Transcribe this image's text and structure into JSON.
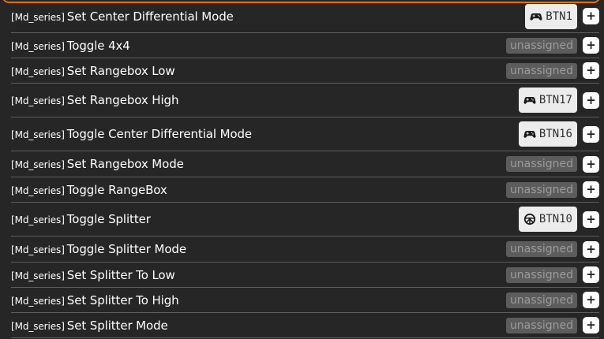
{
  "colors": {
    "background": "#262626",
    "accent": "#e0730f",
    "binding_bg": "#ececec",
    "unassigned_bg": "#5c5c5c"
  },
  "add_label": "+",
  "rows": [
    {
      "prefix": "[Md_series]",
      "name": "Set Center Differential Mode",
      "binding": "BTN1",
      "icon": "gamepad-icon"
    },
    {
      "prefix": "[Md_series]",
      "name": "Toggle 4x4",
      "binding": "unassigned",
      "icon": ""
    },
    {
      "prefix": "[Md_series]",
      "name": "Set Rangebox Low",
      "binding": "unassigned",
      "icon": ""
    },
    {
      "prefix": "[Md_series]",
      "name": "Set Rangebox High",
      "binding": "BTN17",
      "icon": "gamepad-icon"
    },
    {
      "prefix": "[Md_series]",
      "name": "Toggle Center Differential Mode",
      "binding": "BTN16",
      "icon": "gamepad-icon"
    },
    {
      "prefix": "[Md_series]",
      "name": "Set Rangebox Mode",
      "binding": "unassigned",
      "icon": ""
    },
    {
      "prefix": "[Md_series]",
      "name": "Toggle RangeBox",
      "binding": "unassigned",
      "icon": ""
    },
    {
      "prefix": "[Md_series]",
      "name": "Toggle Splitter",
      "binding": "BTN10",
      "icon": "steering-wheel-icon"
    },
    {
      "prefix": "[Md_series]",
      "name": "Toggle Splitter Mode",
      "binding": "unassigned",
      "icon": ""
    },
    {
      "prefix": "[Md_series]",
      "name": "Set Splitter To Low",
      "binding": "unassigned",
      "icon": ""
    },
    {
      "prefix": "[Md_series]",
      "name": "Set Splitter To High",
      "binding": "unassigned",
      "icon": ""
    },
    {
      "prefix": "[Md_series]",
      "name": "Set Splitter Mode",
      "binding": "unassigned",
      "icon": ""
    }
  ]
}
